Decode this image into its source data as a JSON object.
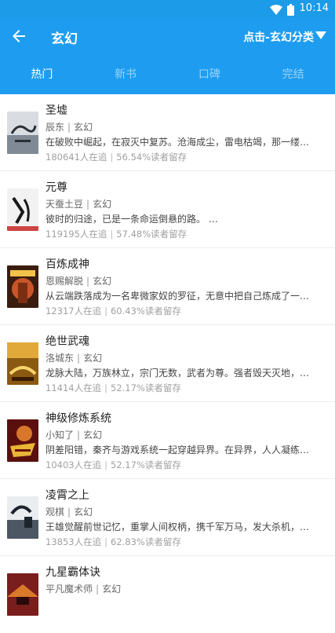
{
  "status_bar": {
    "time": "10:14"
  },
  "header": {
    "title": "玄幻",
    "category_button": "点击-玄幻分类"
  },
  "tabs": [
    {
      "label": "热门",
      "active": true
    },
    {
      "label": "新书",
      "active": false
    },
    {
      "label": "口碑",
      "active": false
    },
    {
      "label": "完结",
      "active": false
    }
  ],
  "books": [
    {
      "title": "圣墟",
      "author": "辰东",
      "genre": "玄幻",
      "description": "在破败中崛起，在寂灭中复苏。沧海成尘，雷电枯竭，那一缕…",
      "followers": "180641人在追",
      "retention": "56.54%读者留存"
    },
    {
      "title": "元尊",
      "author": "天蚕土豆",
      "genre": "玄幻",
      "description": "彼时的归途，已是一条命运倒悬的路。 …",
      "followers": "119195人在追",
      "retention": "57.48%读者留存"
    },
    {
      "title": "百炼成神",
      "author": "恩赐解脱",
      "genre": "玄幻",
      "description": "从云端跌落成为一名卑微家奴的罗征，无意中把自己炼成了一…",
      "followers": "12317人在追",
      "retention": "60.43%读者留存"
    },
    {
      "title": "绝世武魂",
      "author": "洛城东",
      "genre": "玄幻",
      "description": "龙脉大陆，万族林立，宗门无数，武者为尊。强者毁天灭地，…",
      "followers": "11414人在追",
      "retention": "52.17%读者留存"
    },
    {
      "title": "神级修炼系统",
      "author": "小知了",
      "genre": "玄幻",
      "description": "阴差阳错，秦齐与游戏系统一起穿越异界。在异界，人人凝练…",
      "followers": "10403人在追",
      "retention": "52.17%读者留存"
    },
    {
      "title": "凌霄之上",
      "author": "观棋",
      "genre": "玄幻",
      "description": "王雄觉醒前世记忆，重掌人间权柄，携千军万马，发大杀机，…",
      "followers": "13853人在追",
      "retention": "62.83%读者留存"
    },
    {
      "title": "九星霸体诀",
      "author": "平凡魔术师",
      "genre": "玄幻",
      "description": "",
      "followers": "",
      "retention": ""
    }
  ]
}
